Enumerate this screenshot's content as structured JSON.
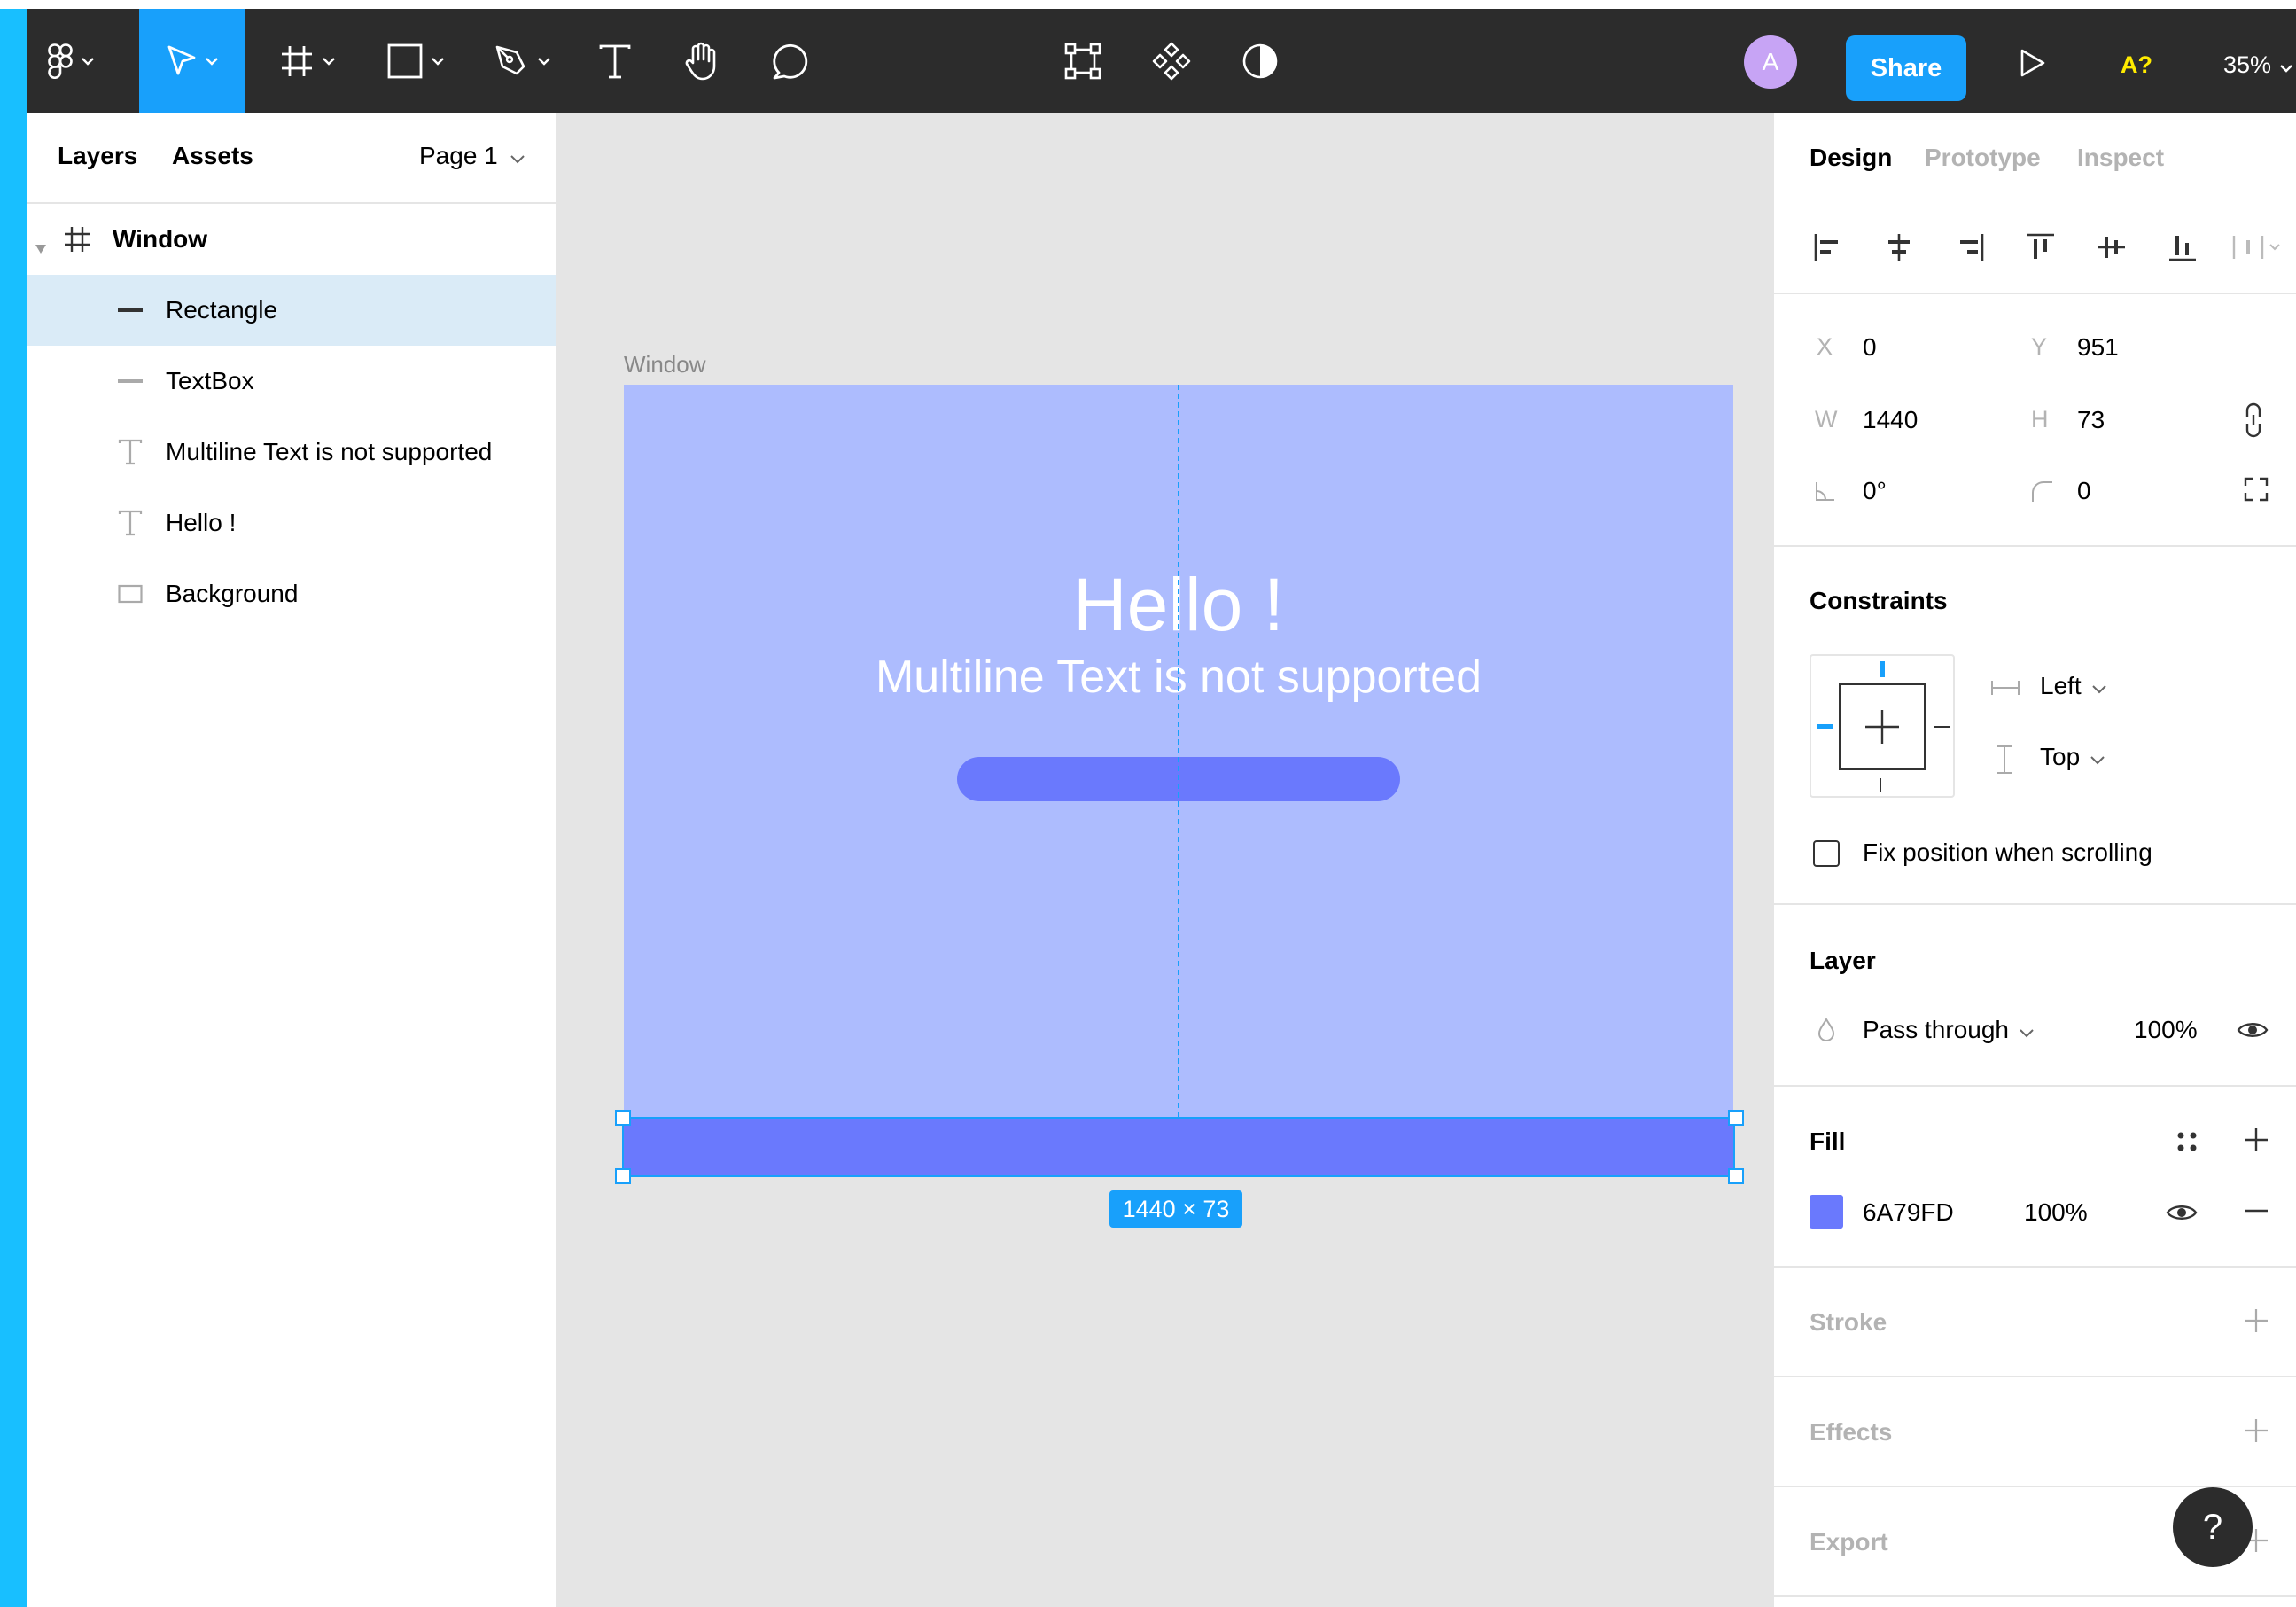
{
  "colors": {
    "accent": "#18A0FB",
    "toolbar_bg": "#2c2c2c",
    "frame_fill": "#ADBCFE",
    "rect_fill": "#6A79FD",
    "warning": "#FFEB00",
    "avatar": "#C7A4F5"
  },
  "toolbar": {
    "icons": [
      "figma-logo-icon",
      "move-tool-icon",
      "frame-tool-icon",
      "shape-tool-icon",
      "pen-tool-icon",
      "text-tool-icon",
      "hand-tool-icon",
      "comment-tool-icon",
      "component-bounds-icon",
      "components-icon",
      "contrast-icon",
      "play-icon"
    ],
    "avatar_initial": "A",
    "share_label": "Share",
    "missing_fonts_label": "A?",
    "zoom_label": "35%"
  },
  "left_panel": {
    "tabs": [
      "Layers",
      "Assets"
    ],
    "page_selector": "Page 1",
    "layers": [
      {
        "name": "Window",
        "icon": "frame-icon"
      },
      {
        "name": "Rectangle",
        "icon": "line-icon",
        "selected": true
      },
      {
        "name": "TextBox",
        "icon": "line-icon"
      },
      {
        "name": "Multiline Text is not supported",
        "icon": "text-icon"
      },
      {
        "name": "Hello !",
        "icon": "text-icon"
      },
      {
        "name": "Background",
        "icon": "rectangle-icon"
      }
    ]
  },
  "canvas": {
    "frame_label": "Window",
    "hello_text": "Hello !",
    "multiline_text": "Multiline Text is not supported",
    "selection_size": "1440 × 73"
  },
  "right_panel": {
    "tabs": [
      "Design",
      "Prototype",
      "Inspect"
    ],
    "active_tab": "Design",
    "position": {
      "x_label": "X",
      "x": "0",
      "y_label": "Y",
      "y": "951"
    },
    "size": {
      "w_label": "W",
      "w": "1440",
      "h_label": "H",
      "h": "73"
    },
    "rotation": "0°",
    "corner_radius": "0",
    "constraints": {
      "title": "Constraints",
      "horizontal": "Left",
      "vertical": "Top",
      "fix_position_label": "Fix position when scrolling"
    },
    "layer": {
      "title": "Layer",
      "blend_mode": "Pass through",
      "opacity": "100%"
    },
    "fill": {
      "title": "Fill",
      "hex": "6A79FD",
      "opacity": "100%"
    },
    "stroke_title": "Stroke",
    "effects_title": "Effects",
    "export_title": "Export"
  },
  "help_label": "?"
}
